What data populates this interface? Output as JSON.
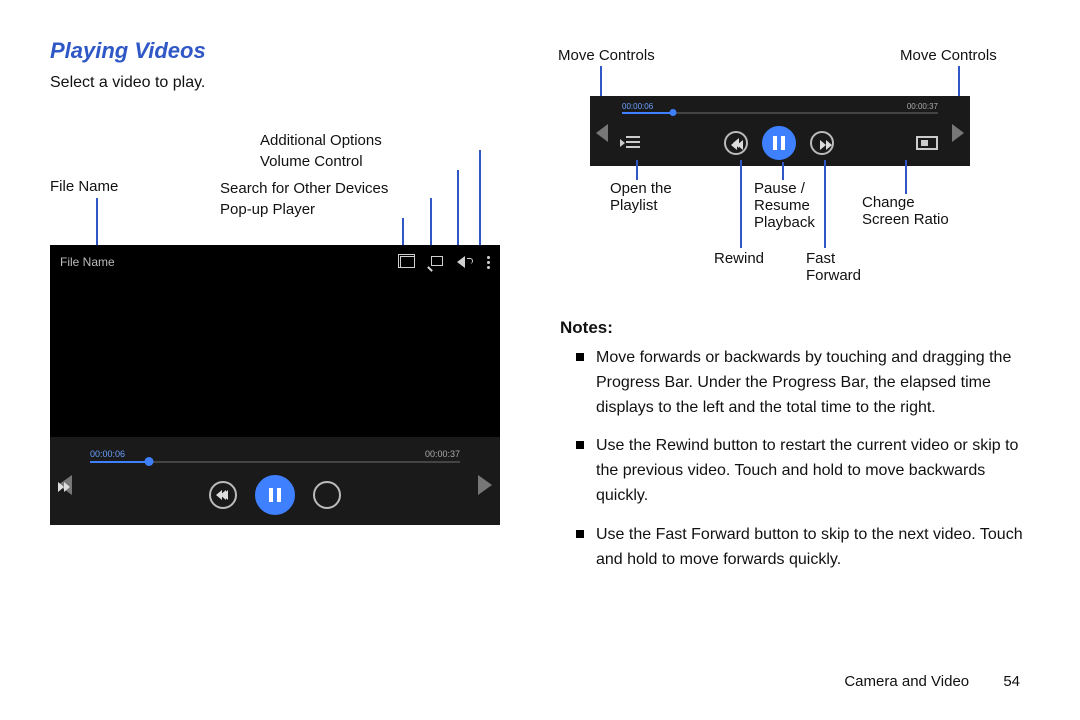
{
  "heading": "Playing Videos",
  "subtext": "Select a video to play.",
  "labels": {
    "file_name": "File Name",
    "additional_options": "Additional Options",
    "volume_control": "Volume Control",
    "search_devices": "Search for Other Devices",
    "popup_player": "Pop-up Player",
    "move_controls_l": "Move Controls",
    "move_controls_r": "Move Controls",
    "open_playlist": "Open the\nPlaylist",
    "pause_resume": "Pause /\nResume\nPlayback",
    "change_ratio": "Change\nScreen Ratio",
    "rewind": "Rewind",
    "fast_forward": "Fast\nForward"
  },
  "player": {
    "filename": "File Name",
    "elapsed": "00:00:06",
    "total": "00:00:37"
  },
  "notes_heading": "Notes:",
  "notes": [
    "Move forwards or backwards by touching and dragging the Progress Bar. Under the Progress Bar, the elapsed time displays to the left and the total time to the right.",
    "Use the Rewind button to restart the current video or skip to the previous video. Touch and hold to move backwards quickly.",
    "Use the Fast Forward button to skip to the next video. Touch and hold to move forwards quickly."
  ],
  "footer_section": "Camera and Video",
  "footer_page": "54"
}
